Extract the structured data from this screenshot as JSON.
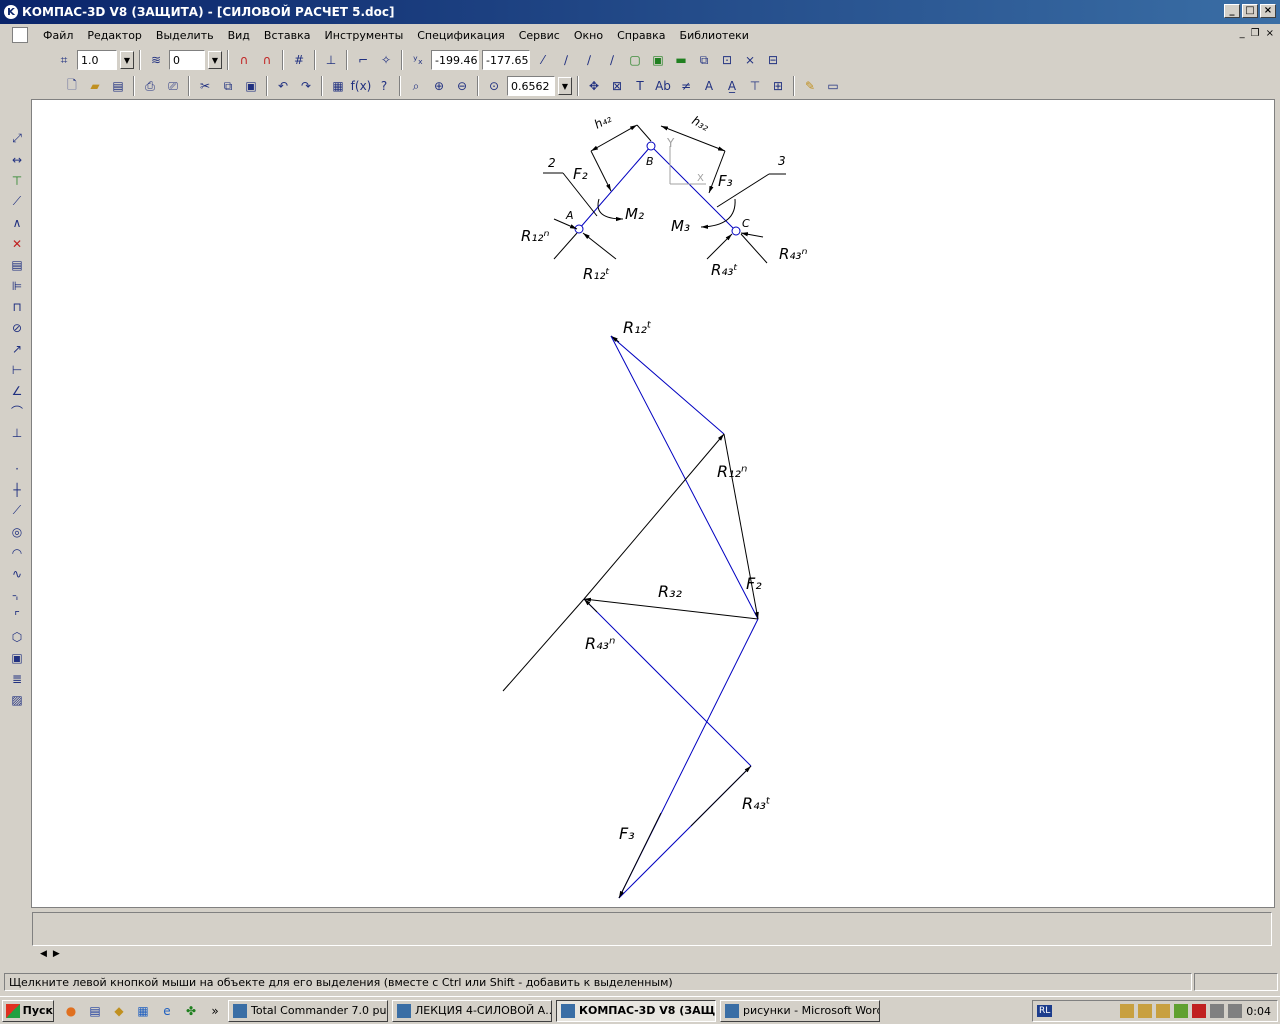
{
  "window": {
    "title": "КОМПАС-3D V8 (ЗАЩИТА) - [СИЛОВОЙ РАСЧЕТ 5.doc]"
  },
  "menu": [
    "Файл",
    "Редактор",
    "Выделить",
    "Вид",
    "Вставка",
    "Инструменты",
    "Спецификация",
    "Сервис",
    "Окно",
    "Справка",
    "Библиотеки"
  ],
  "toolbar": {
    "scale_value": "1.0",
    "layer_value": "0",
    "coord_x": "-199.46",
    "coord_y": "-177.65",
    "zoom_value": "0.6562"
  },
  "drawing": {
    "labels": {
      "h42": "h₄₂",
      "h32": "h₃₂",
      "B": "B",
      "Y": "Y",
      "X": "X",
      "two": "2",
      "three": "3",
      "F2_top": "F₂",
      "F3_top": "F₃",
      "A": "A",
      "C": "C",
      "M2": "M₂",
      "M3": "M₃",
      "R12n_top": "R₁₂ⁿ",
      "R12t_top": "R₁₂ᵗ",
      "R43t_top": "R₄₃ᵗ",
      "R43n_top": "R₄₃ⁿ",
      "R12t_poly": "R₁₂ᵗ",
      "R12n_poly": "R₁₂ⁿ",
      "F2_poly": "F₂",
      "R32_poly": "R₃₂",
      "R43n_poly": "R₄₃ⁿ",
      "R43t_poly": "R₄₃ᵗ",
      "F3_poly": "F₃"
    }
  },
  "status": {
    "hint": "Щелкните левой кнопкой мыши на объекте для его выделения (вместе с Ctrl или Shift - добавить к выделенным)"
  },
  "taskbar": {
    "start": "Пуск",
    "tasks": [
      "Total Commander 7.0 pu...",
      "ЛЕКЦИЯ 4-СИЛОВОЙ А...",
      "КОМПАС-3D V8 (ЗАЩ...",
      "рисунки - Microsoft Word"
    ],
    "lang": "RL",
    "clock": "0:04"
  }
}
